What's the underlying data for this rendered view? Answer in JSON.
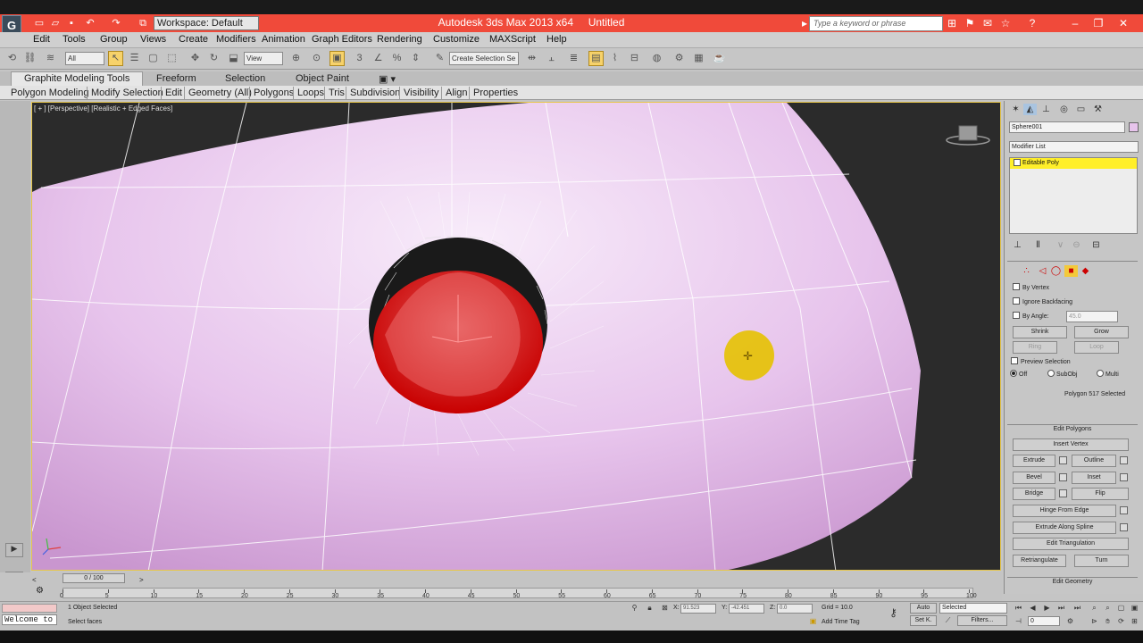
{
  "window": {
    "title": "Autodesk 3ds Max  2013 x64",
    "document": "Untitled",
    "workspace": "Workspace: Default",
    "search_placeholder": "Type a keyword or phrase",
    "logo": "G"
  },
  "menu": [
    "Edit",
    "Tools",
    "Group",
    "Views",
    "Create",
    "Modifiers",
    "Animation",
    "Graph Editors",
    "Rendering",
    "Customize",
    "MAXScript",
    "Help"
  ],
  "toolbar": {
    "filter_value": "All",
    "refcoord_value": "View",
    "named_selection": "Create Selection Se"
  },
  "ribbon": {
    "tabs": [
      "Graphite Modeling Tools",
      "Freeform",
      "Selection",
      "Object Paint"
    ],
    "panels": [
      "Polygon Modeling",
      "Modify Selection",
      "Edit",
      "Geometry (All)",
      "Polygons",
      "Loops",
      "Tris",
      "Subdivision",
      "Visibility",
      "Align",
      "Properties"
    ]
  },
  "viewport": {
    "label": "[ + ] [Perspective] [Realistic + Edged Faces]"
  },
  "command_panel": {
    "object_name": "Sphere001",
    "modifier_list": "Modifier List",
    "modifier_stack": [
      "Editable Poly"
    ],
    "by_vertex": "By Vertex",
    "ignore_backfacing": "Ignore Backfacing",
    "by_angle": "By Angle:",
    "by_angle_value": "45.0",
    "shrink": "Shrink",
    "grow": "Grow",
    "ring": "Ring",
    "loop": "Loop",
    "preview_selection": "Preview Selection",
    "preview_off": "Off",
    "preview_subobj": "SubObj",
    "preview_multi": "Multi",
    "selection_info": "Polygon 517 Selected",
    "edit_polygons_title": "Edit Polygons",
    "insert_vertex": "Insert Vertex",
    "extrude": "Extrude",
    "outline": "Outline",
    "bevel": "Bevel",
    "inset": "Inset",
    "bridge": "Bridge",
    "flip": "Flip",
    "hinge_from_edge": "Hinge From Edge",
    "extrude_along_spline": "Extrude Along Spline",
    "edit_triangulation": "Edit Triangulation",
    "retriangulate": "Retriangulate",
    "turn": "Turn",
    "edit_geometry_title": "Edit Geometry"
  },
  "timeline": {
    "frame_label": "0 / 100",
    "ticks": [
      "0",
      "5",
      "10",
      "15",
      "20",
      "25",
      "30",
      "35",
      "40",
      "45",
      "50",
      "55",
      "60",
      "65",
      "70",
      "75",
      "80",
      "85",
      "90",
      "95",
      "100"
    ],
    "current_frame": 0,
    "total_frames": 100
  },
  "status": {
    "selected": "1 Object Selected",
    "prompt": "Select faces",
    "x_label": "X:",
    "x_value": "91.523",
    "y_label": "Y:",
    "y_value": "-42.451",
    "z_label": "Z:",
    "z_value": "0.0",
    "grid": "Grid = 10.0",
    "add_time_tag": "Add Time Tag",
    "auto": "Auto",
    "set_key": "Set K.",
    "key_mode": "Selected",
    "filters": "Filters...",
    "frame_value": "0",
    "welcome": "Welcome to"
  },
  "colors": {
    "title_bar": "#f04a3a",
    "highlight": "#ffef2a",
    "selected_face": "#d80000",
    "sphere": "#e7c2ec"
  }
}
